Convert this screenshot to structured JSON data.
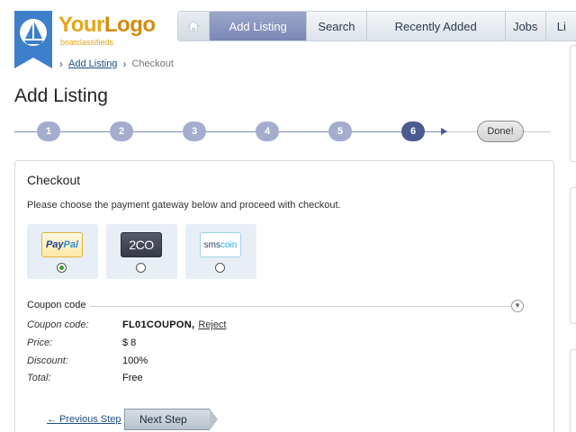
{
  "logo": {
    "name": "YourLogo",
    "name_part1": "Your",
    "name_part2": "Logo",
    "subtitle": "boatclassifieds",
    "icon": "sailboat-icon",
    "colors": {
      "badge": "#3d7fcb",
      "text": "#e8a417"
    }
  },
  "nav": {
    "home_icon": "home-icon",
    "items": [
      {
        "label": "Add Listing",
        "active": true
      },
      {
        "label": "Search"
      },
      {
        "label": "Recently Added"
      },
      {
        "label": "Jobs"
      },
      {
        "label": "Li"
      }
    ]
  },
  "breadcrumb": {
    "link": "Add Listing",
    "current": "Checkout"
  },
  "page": {
    "title": "Add Listing"
  },
  "steps": {
    "items": [
      "1",
      "2",
      "3",
      "4",
      "5",
      "6"
    ],
    "current": "6",
    "done_label": "Done!"
  },
  "checkout": {
    "title": "Checkout",
    "instruction": "Please choose the payment gateway below and proceed with checkout.",
    "gateways": [
      {
        "name": "PayPal",
        "part1": "Pay",
        "part2": "Pal",
        "selected": true
      },
      {
        "name": "2CO",
        "selected": false
      },
      {
        "name": "smscoin",
        "part1": "sms",
        "part2": "coin",
        "selected": false
      }
    ],
    "coupon": {
      "section_label": "Coupon code",
      "toggle_icon": "chevron-down-icon",
      "rows": {
        "coupon_label": "Coupon code:",
        "coupon_value": "FL01COUPON,",
        "reject_label": "Reject",
        "price_label": "Price:",
        "price_value": "$ 8",
        "discount_label": "Discount:",
        "discount_value": "100%",
        "total_label": "Total:",
        "total_value": "Free"
      }
    },
    "prev_label": "← Previous Step",
    "next_label": "Next Step"
  },
  "colors": {
    "accent": "#7b88b5",
    "step_current": "#4c5b8f",
    "step": "#a5adcf",
    "link": "#1d4f86"
  }
}
